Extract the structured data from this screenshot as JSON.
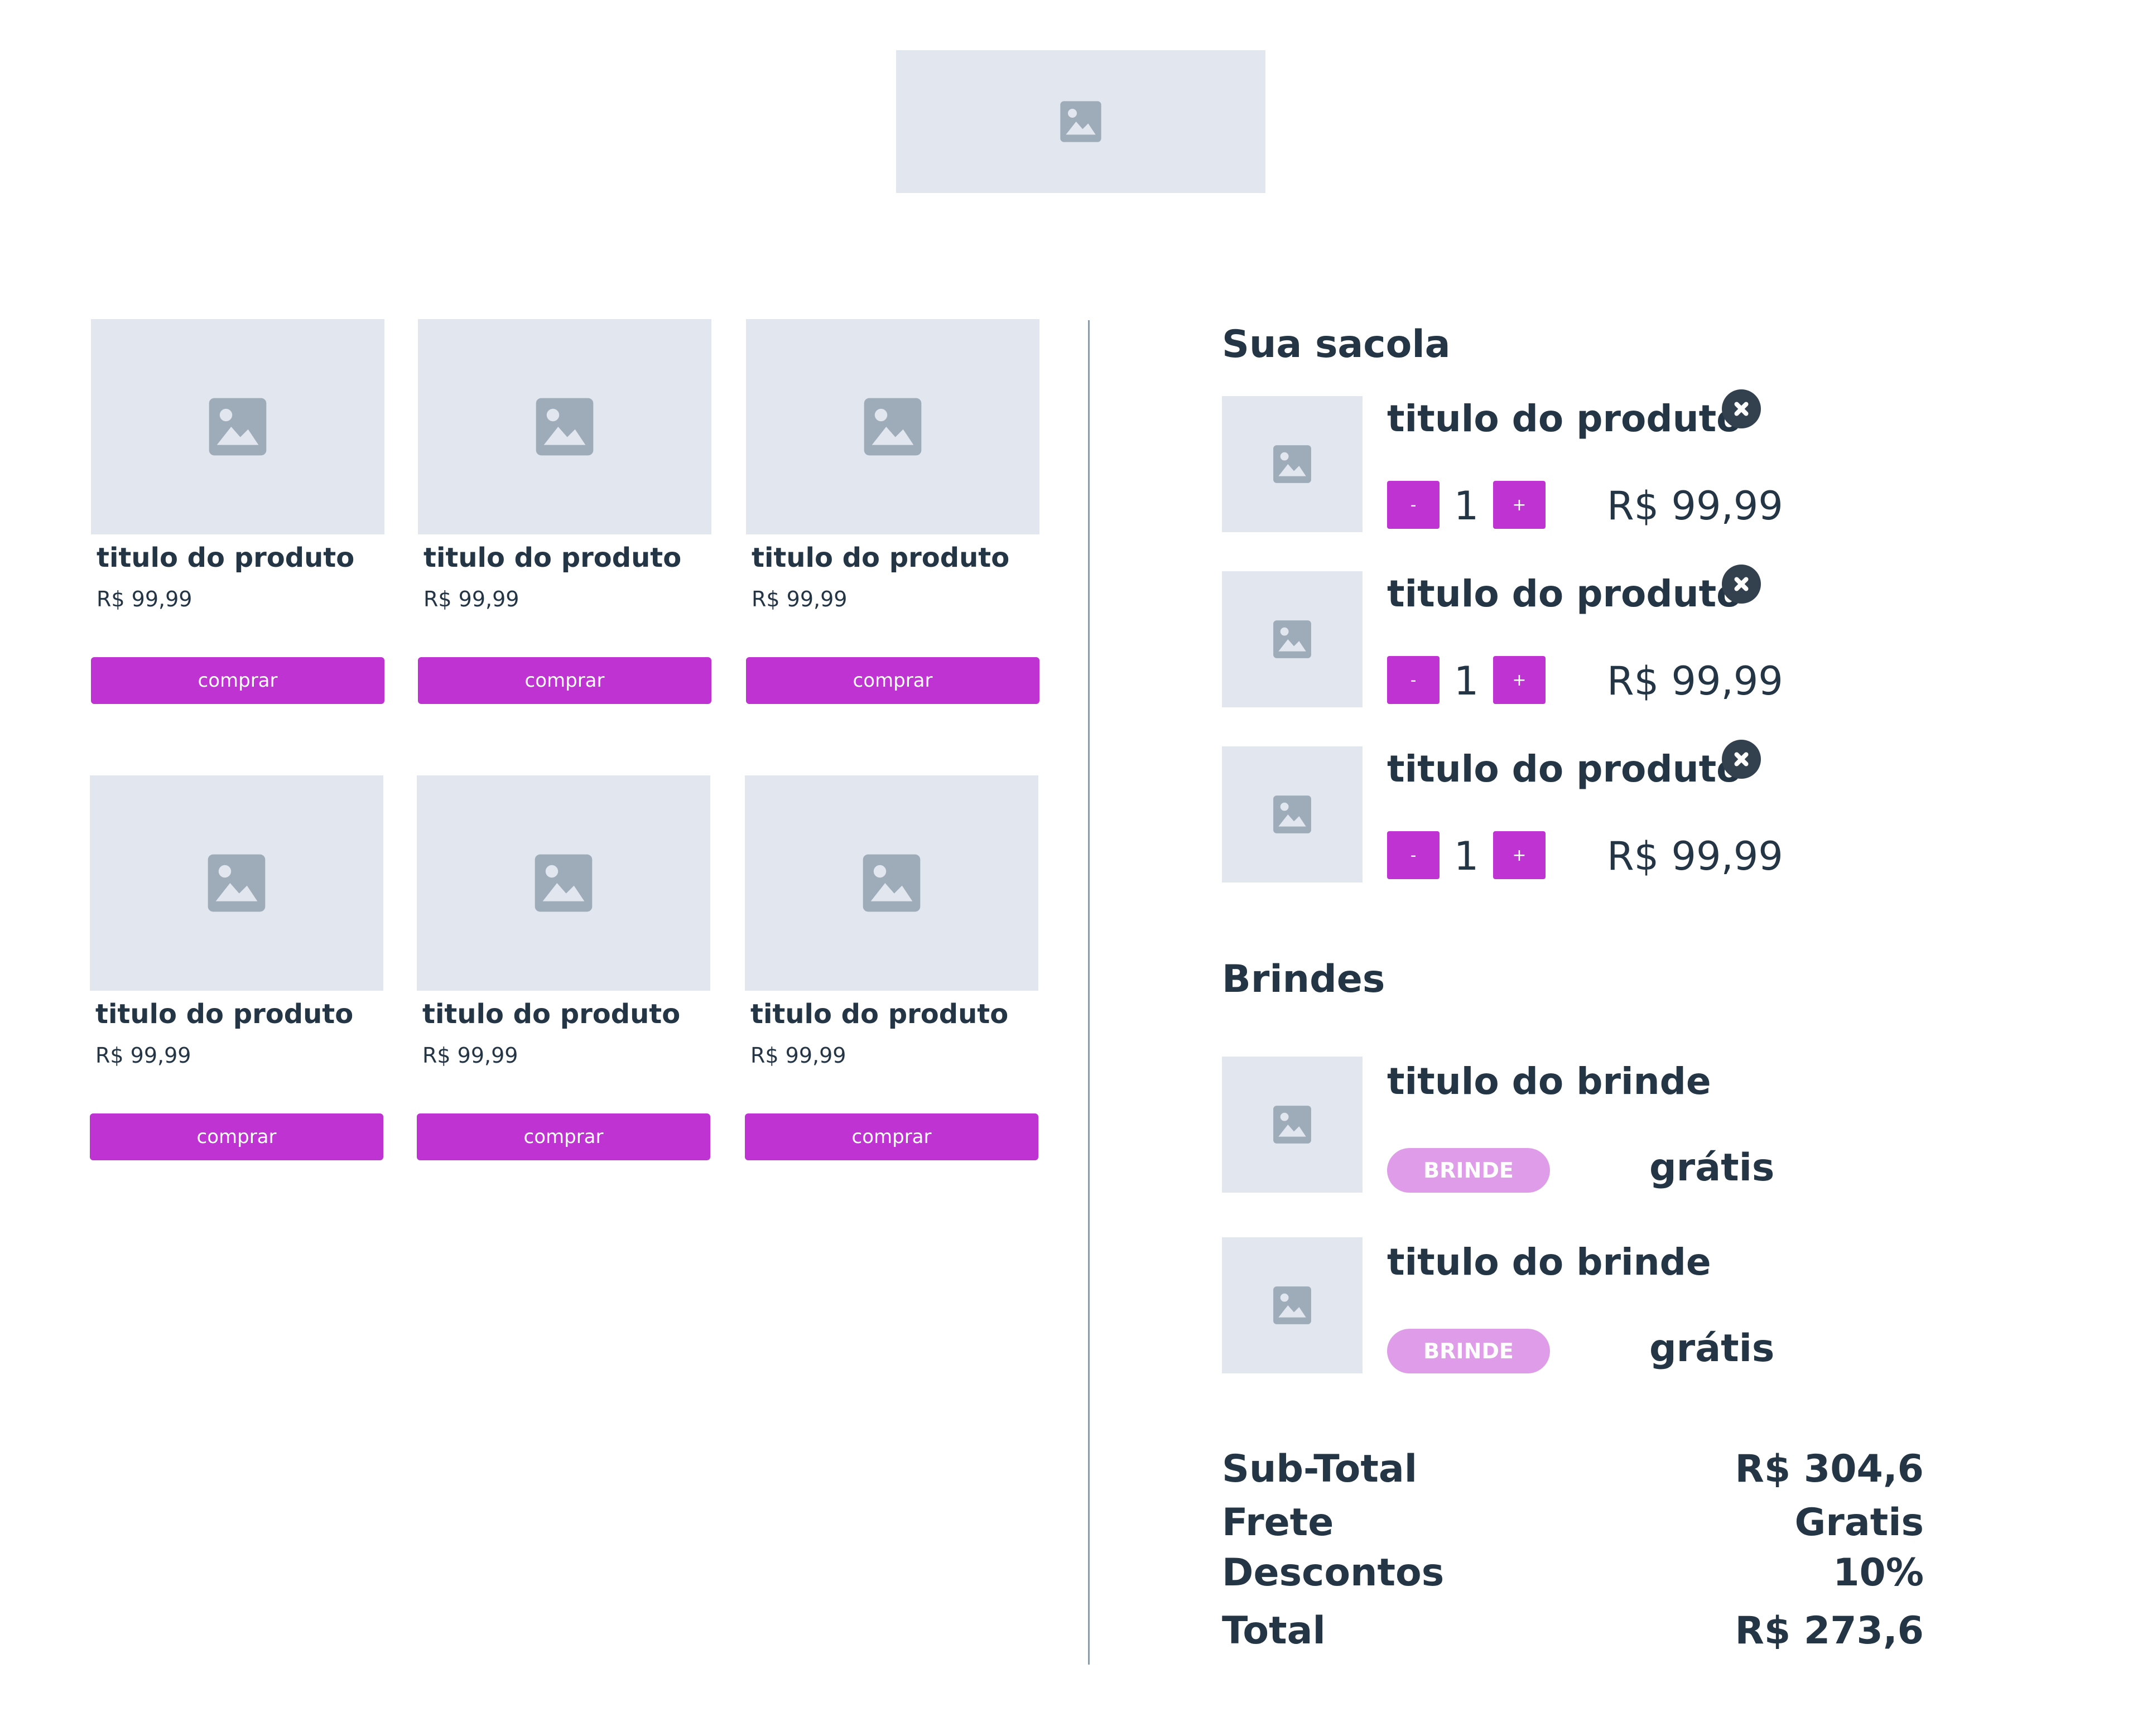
{
  "header": {
    "logo_icon": "image-placeholder-icon"
  },
  "catalog": {
    "products": [
      {
        "title": "titulo do produto",
        "price": "R$ 99,99",
        "buy_label": "comprar"
      },
      {
        "title": "titulo do produto",
        "price": "R$ 99,99",
        "buy_label": "comprar"
      },
      {
        "title": "titulo do produto",
        "price": "R$ 99,99",
        "buy_label": "comprar"
      },
      {
        "title": "titulo do produto",
        "price": "R$ 99,99",
        "buy_label": "comprar"
      },
      {
        "title": "titulo do produto",
        "price": "R$ 99,99",
        "buy_label": "comprar"
      },
      {
        "title": "titulo do produto",
        "price": "R$ 99,99",
        "buy_label": "comprar"
      }
    ]
  },
  "bag": {
    "title": "Sua sacola",
    "items": [
      {
        "title": "titulo do produto",
        "minus_label": "-",
        "quantity": "1",
        "plus_label": "+",
        "price": "R$ 99,99"
      },
      {
        "title": "titulo do produto",
        "minus_label": "-",
        "quantity": "1",
        "plus_label": "+",
        "price": "R$ 99,99"
      },
      {
        "title": "titulo do produto",
        "minus_label": "-",
        "quantity": "1",
        "plus_label": "+",
        "price": "R$ 99,99"
      }
    ]
  },
  "gifts": {
    "title": "Brindes",
    "items": [
      {
        "title": "titulo do brinde",
        "badge": "BRINDE",
        "price": "grátis"
      },
      {
        "title": "titulo do brinde",
        "badge": "BRINDE",
        "price": "grátis"
      }
    ]
  },
  "summary": {
    "subtotal_label": "Sub-Total",
    "subtotal_value": "R$ 304,6",
    "shipping_label": "Frete",
    "shipping_value": "Gratis",
    "discount_label": "Descontos",
    "discount_value": "10%",
    "total_label": "Total",
    "total_value": "R$ 273,6"
  },
  "colors": {
    "accent": "#bf33d3",
    "badge": "#df9de9",
    "placeholder": "#e2e7ef",
    "placeholder_icon": "#9eacb9",
    "text": "#243545",
    "divider": "#8d9aa7"
  }
}
